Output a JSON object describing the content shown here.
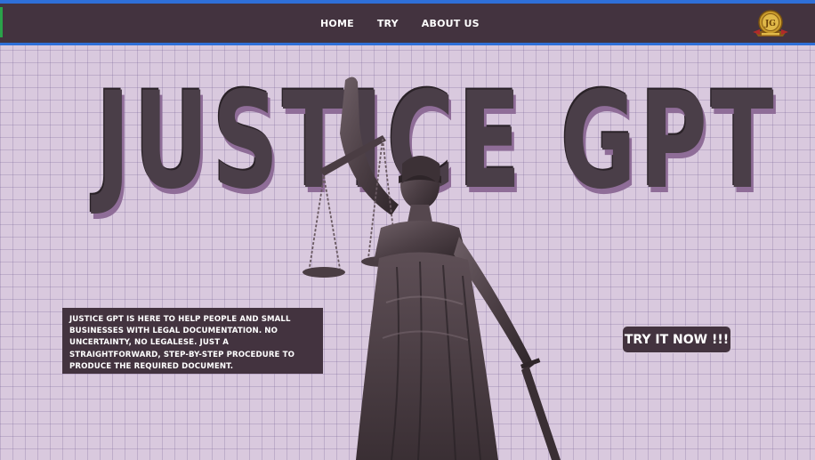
{
  "nav": {
    "links": [
      {
        "label": "HOME"
      },
      {
        "label": "TRY"
      },
      {
        "label": "ABOUT US"
      }
    ],
    "logo_icon": "gold-emblem-icon"
  },
  "hero": {
    "title": "JUSTICE GPT",
    "image": "lady-justice-statue",
    "description": "JUSTICE GPT IS HERE TO HELP PEOPLE AND SMALL BUSINESSES WITH LEGAL DOCUMENTATION. NO UNCERTAINTY, NO LEGALESE. JUST A STRAIGHTFORWARD, STEP-BY-STEP PROCEDURE TO PRODUCE THE REQUIRED DOCUMENT.",
    "cta_label": "TRY IT NOW !!!"
  },
  "colors": {
    "background": "#d9c9de",
    "navbar": "#43333f",
    "accent_blue": "#2e6fd8",
    "title": "#4a3e48",
    "title_shadow": "#8f6d98"
  }
}
